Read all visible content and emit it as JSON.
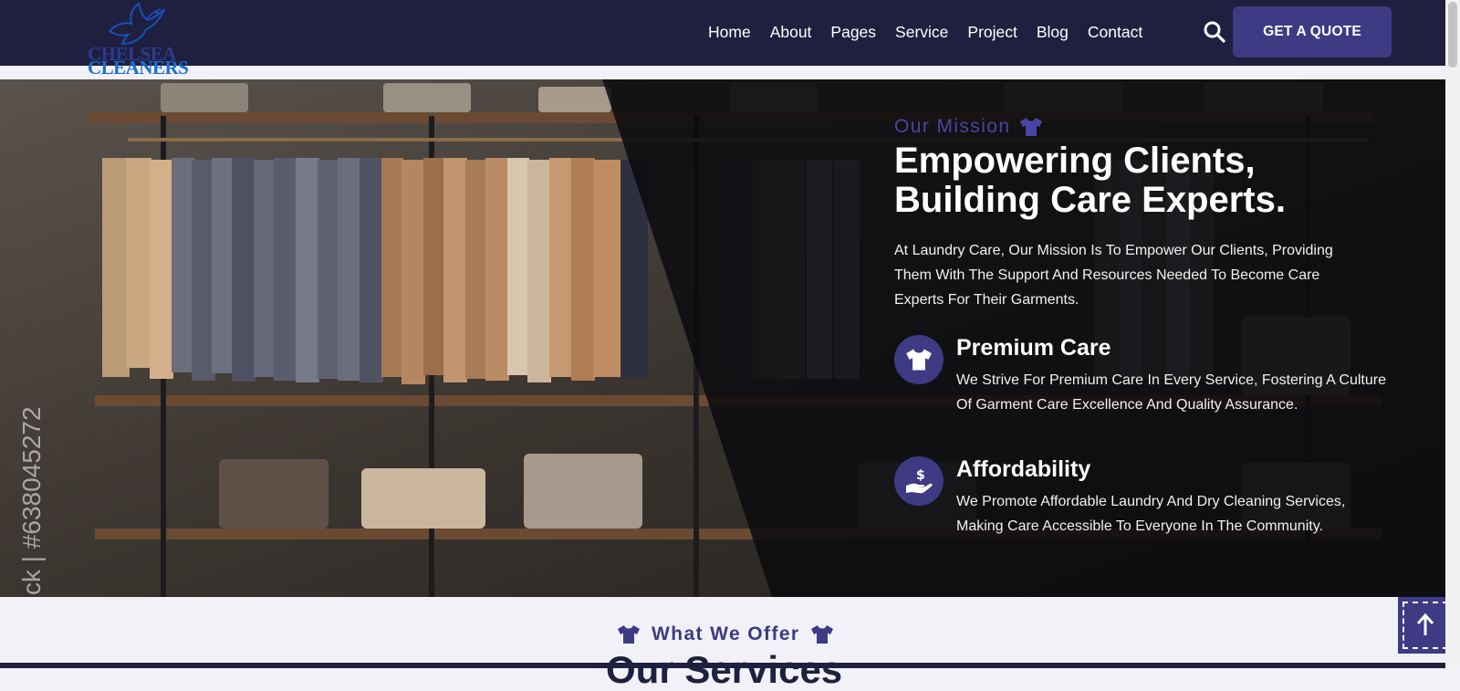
{
  "header": {
    "logo": {
      "line1": "CHELSEA",
      "line2": "CLEANERS",
      "icon": "dove-icon"
    },
    "nav": [
      "Home",
      "About",
      "Pages",
      "Service",
      "Project",
      "Blog",
      "Contact"
    ],
    "search_icon": "search-icon",
    "quote_label": "GET A QUOTE"
  },
  "hero": {
    "watermark": "ck | #638045272",
    "eyebrow": "Our Mission",
    "headline": [
      "Empowering Clients,",
      "Building Care Experts."
    ],
    "lead": "At Laundry Care, Our Mission Is To Empower Our Clients, Providing Them With The Support And Resources Needed To Become Care Experts For Their Garments.",
    "features": [
      {
        "icon": "tshirt-icon",
        "title": "Premium Care",
        "desc": "We Strive For Premium Care In Every Service, Fostering A Culture Of Garment Care Excellence And Quality Assurance."
      },
      {
        "icon": "hand-dollar-icon",
        "title": "Affordability",
        "desc": "We Promote Affordable Laundry And Dry Cleaning Services, Making Care Accessible To Everyone In The Community."
      }
    ]
  },
  "offer": {
    "eyebrow": "What We Offer",
    "title": "Our Services"
  },
  "scroll_top_icon": "arrow-up-icon",
  "colors": {
    "header_bg": "#1f2040",
    "accent": "#3e3a84",
    "eyebrow": "#4a45a5",
    "page_bg": "#f1f1f7"
  }
}
